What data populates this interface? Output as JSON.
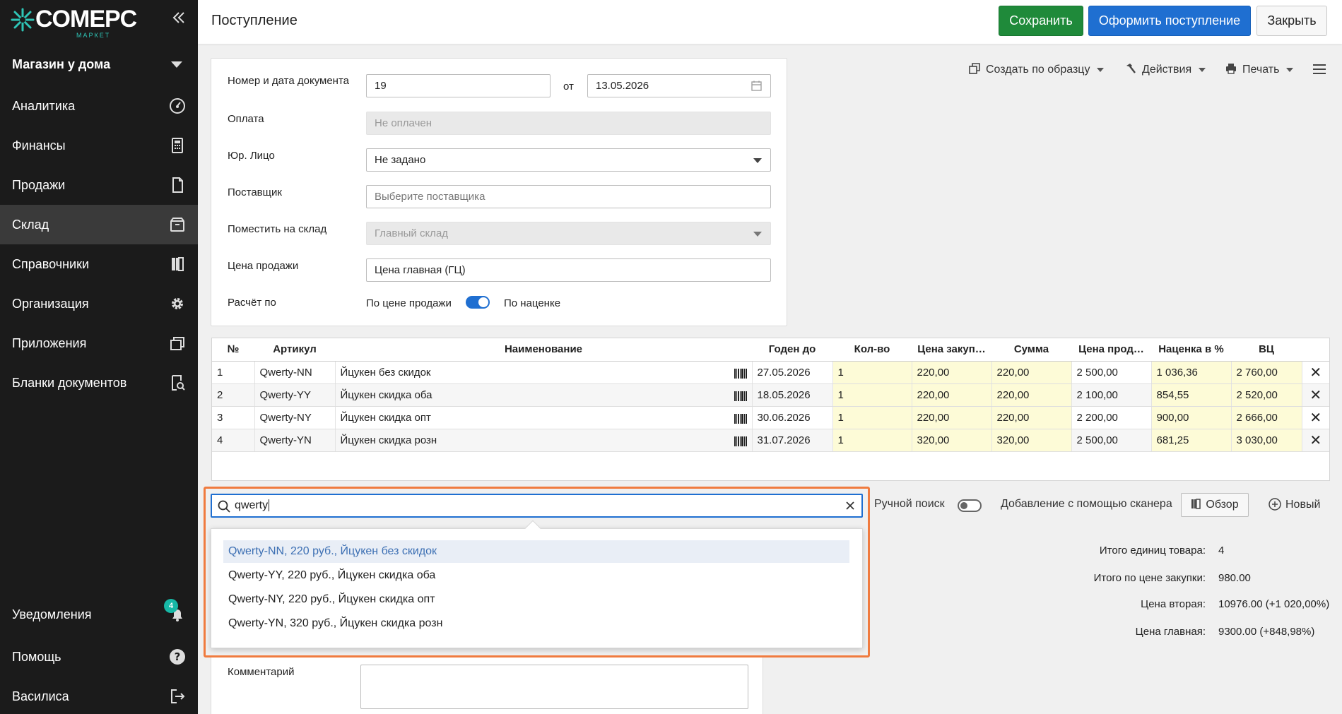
{
  "sidebar": {
    "logo": {
      "brand": "COMEPC",
      "sub": "МАРКЕТ"
    },
    "store": "Магазин у дома",
    "items": [
      {
        "label": "Аналитика",
        "icon": "gauge-icon"
      },
      {
        "label": "Финансы",
        "icon": "calculator-icon"
      },
      {
        "label": "Продажи",
        "icon": "document-icon"
      },
      {
        "label": "Склад",
        "icon": "box-icon",
        "active": true
      },
      {
        "label": "Справочники",
        "icon": "books-icon"
      },
      {
        "label": "Организация",
        "icon": "gear-icon"
      },
      {
        "label": "Приложения",
        "icon": "windows-icon"
      },
      {
        "label": "Бланки документов",
        "icon": "form-search-icon"
      }
    ],
    "bottom": [
      {
        "label": "Уведомления",
        "icon": "bell-icon",
        "badge": "4"
      },
      {
        "label": "Помощь",
        "icon": "help-icon"
      },
      {
        "label": "Василиса",
        "icon": "logout-icon"
      }
    ]
  },
  "header": {
    "title": "Поступление",
    "save_label": "Сохранить",
    "post_label": "Оформить поступление",
    "close_label": "Закрыть"
  },
  "form": {
    "doc_label": "Номер и дата документа",
    "doc_number": "19",
    "from_label": "от",
    "doc_date": "13.05.2026",
    "payment_label": "Оплата",
    "payment_value": "Не оплачен",
    "legal_label": "Юр. Лицо",
    "legal_value": "Не задано",
    "supplier_label": "Поставщик",
    "supplier_placeholder": "Выберите поставщика",
    "warehouse_label": "Поместить на склад",
    "warehouse_value": "Главный склад",
    "price_label": "Цена продажи",
    "price_value": "Цена главная (ГЦ)",
    "calc_label": "Расчёт по",
    "calc_option_a": "По цене продажи",
    "calc_option_b": "По наценке"
  },
  "toolbar": {
    "create_copy": "Создать по образцу",
    "actions": "Действия",
    "print": "Печать"
  },
  "table": {
    "columns": [
      "№",
      "Артикул",
      "Наименование",
      "Годен до",
      "Кол-во",
      "Цена закуп…",
      "Сумма",
      "Цена прод…",
      "Наценка в %",
      "ВЦ"
    ],
    "rows": [
      [
        "1",
        "Qwerty-NN",
        "Йцукен без скидок",
        "27.05.2026",
        "1",
        "220,00",
        "220,00",
        "2 500,00",
        "1 036,36",
        "2 760,00"
      ],
      [
        "2",
        "Qwerty-YY",
        "Йцукен скидка оба",
        "18.05.2026",
        "1",
        "220,00",
        "220,00",
        "2 100,00",
        "854,55",
        "2 520,00"
      ],
      [
        "3",
        "Qwerty-NY",
        "Йцукен скидка опт",
        "30.06.2026",
        "1",
        "220,00",
        "220,00",
        "2 200,00",
        "900,00",
        "2 666,00"
      ],
      [
        "4",
        "Qwerty-YN",
        "Йцукен скидка розн",
        "31.07.2026",
        "1",
        "320,00",
        "320,00",
        "2 500,00",
        "681,25",
        "3 030,00"
      ]
    ]
  },
  "search": {
    "value": "qwerty",
    "results": [
      "Qwerty-NN, 220 руб., Йцукен без скидок",
      "Qwerty-YY, 220 руб., Йцукен скидка оба",
      "Qwerty-NY, 220 руб., Йцукен скидка опт",
      "Qwerty-YN, 320 руб., Йцукен скидка розн"
    ],
    "manual_label": "Ручной поиск",
    "scanner_label": "Добавление с помощью сканера",
    "browse_label": "Обзор",
    "new_label": "Новый"
  },
  "totals": {
    "units_label": "Итого единиц товара:",
    "units_value": "4",
    "purchase_label": "Итого по цене закупки:",
    "purchase_value": "980.00",
    "second_label": "Цена вторая:",
    "second_value": "10976.00 (+1 020,00%)",
    "main_label": "Цена главная:",
    "main_value": "9300.00 (+848,98%)"
  },
  "comment": {
    "label": "Комментарий"
  },
  "colors": {
    "accent": "#1f6fd1",
    "save": "#1f8a3a",
    "highlight": "#f07b3f",
    "sidebar": "#1b1b1b"
  }
}
